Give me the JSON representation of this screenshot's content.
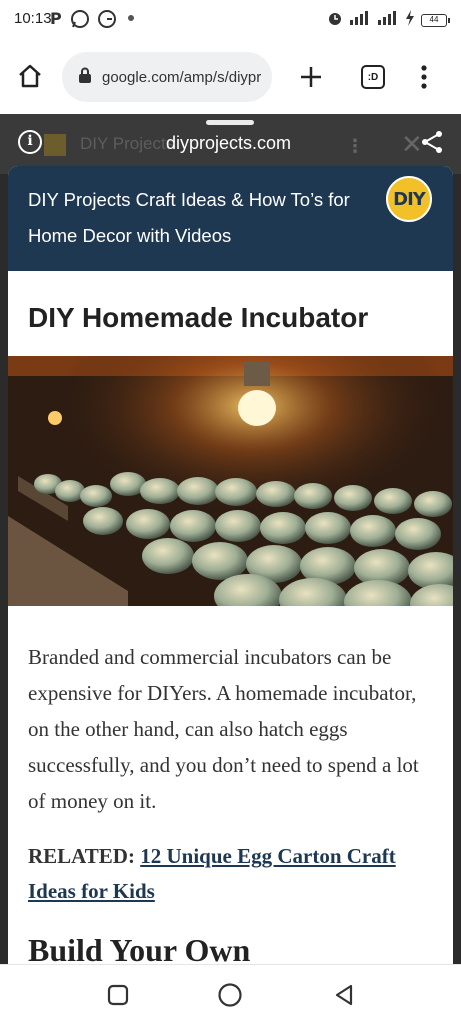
{
  "status_bar": {
    "time": "10:13",
    "app_icons": [
      "P",
      "whatsapp-icon",
      "gmail-icon",
      "notification-dot"
    ],
    "battery_text": "44"
  },
  "browser": {
    "url": "google.com/amp/s/diypr",
    "tab_count_label": ":D"
  },
  "background_page": {
    "title": "DIY Projects"
  },
  "sheet": {
    "domain": "diyprojects.com"
  },
  "article": {
    "site_title": "DIY Projects Craft Ideas & How To’s for Home Decor with Videos",
    "logo_text": "DIY",
    "headline": "DIY Homemade Incubator",
    "body": "Branded and commercial incubators can be expensive for DIYers. A homemade incubator, on the other hand, can also hatch eggs successfully, and you don’t need to spend a lot of money on it.",
    "related_label": "RELATED:",
    "related_link": "12 Unique Egg Carton Craft Ideas for Kids",
    "section_heading": "Build Your Own"
  },
  "colors": {
    "site_header": "#1f3852",
    "logo_yellow": "#f2c029",
    "page_dark": "#2b2b2b"
  }
}
